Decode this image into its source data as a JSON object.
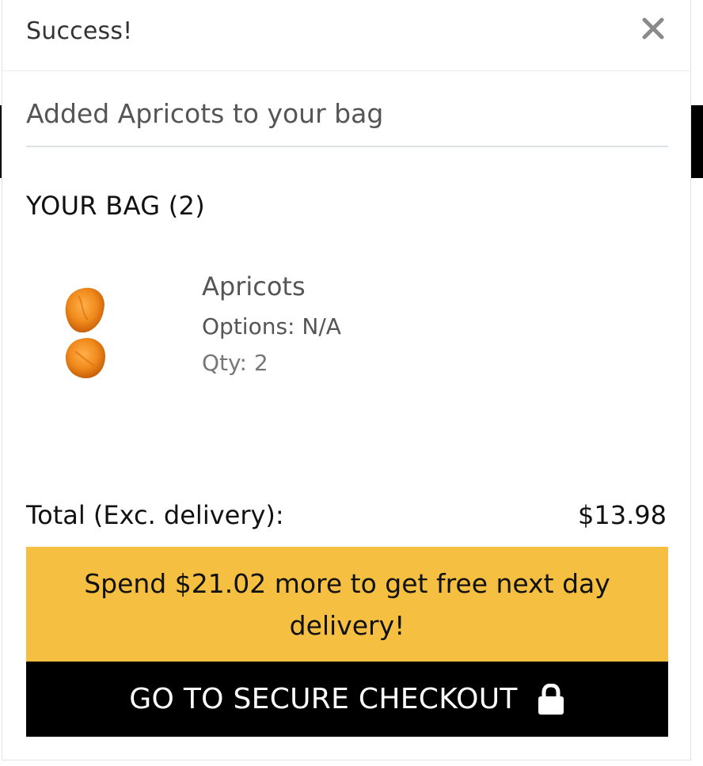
{
  "modal": {
    "title": "Success!",
    "close_icon": "close-icon",
    "added_message": "Added Apricots to your bag"
  },
  "bag": {
    "heading": "YOUR BAG (2)",
    "items": [
      {
        "name": "Apricots",
        "options": "Options: N/A",
        "qty": "Qty: 2",
        "image_icon": "dried-apricots-image"
      }
    ]
  },
  "summary": {
    "total_label": "Total (Exc. delivery):",
    "total_value": "$13.98",
    "promo_text": "Spend $21.02 more to get free next day delivery!"
  },
  "checkout": {
    "label": "GO TO SECURE CHECKOUT",
    "icon": "lock-icon"
  },
  "colors": {
    "promo_bg": "#f5bf42",
    "checkout_bg": "#000000",
    "checkout_text": "#ffffff",
    "apricot": "#f08a1c"
  }
}
